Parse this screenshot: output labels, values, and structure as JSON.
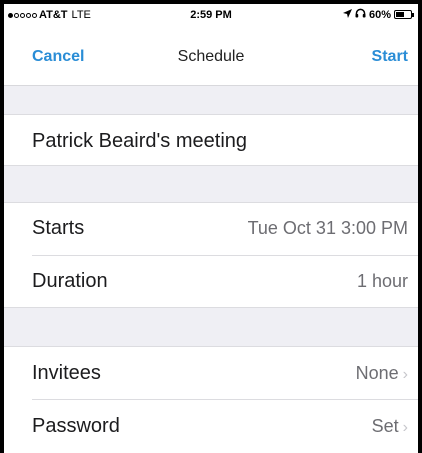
{
  "status_bar": {
    "carrier": "AT&T",
    "network": "LTE",
    "time": "2:59 PM",
    "location_icon": "location-arrow-icon",
    "headphones_icon": "headphones-icon",
    "battery": "60%",
    "battery_level": 0.6
  },
  "nav": {
    "cancel_label": "Cancel",
    "title": "Schedule",
    "start_label": "Start"
  },
  "meeting": {
    "topic": "Patrick Beaird's meeting"
  },
  "timing": {
    "starts_label": "Starts",
    "starts_value": "Tue Oct 31 3:00 PM",
    "duration_label": "Duration",
    "duration_value": "1 hour"
  },
  "options": {
    "invitees_label": "Invitees",
    "invitees_value": "None",
    "password_label": "Password",
    "password_value": "Set"
  },
  "colors": {
    "accent": "#2a8dd6",
    "background": "#efeff4"
  }
}
